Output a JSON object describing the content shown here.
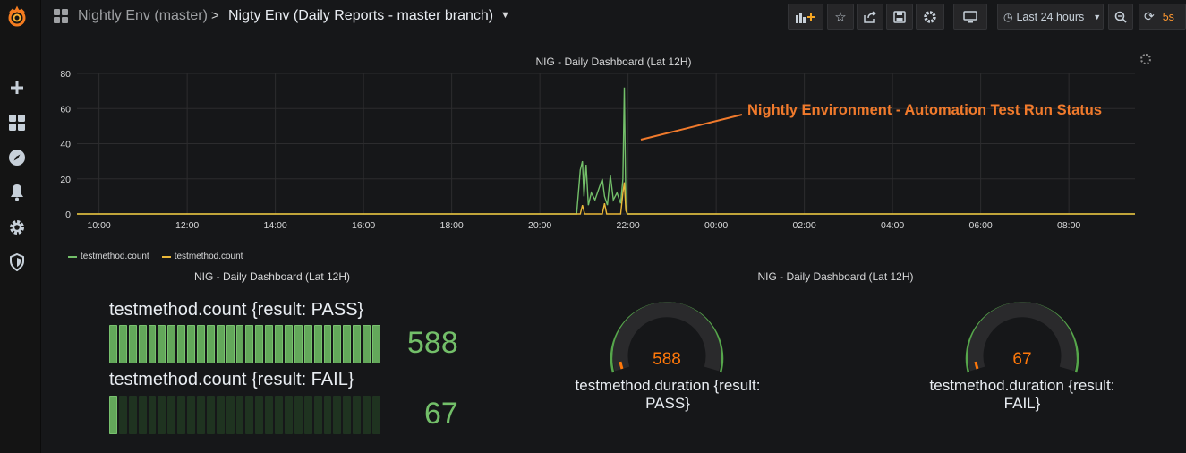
{
  "nav": {
    "icons": [
      "grafana-logo-icon",
      "plus-icon",
      "dashboards-icon",
      "explore-icon",
      "alerting-bell-icon",
      "configuration-gear-icon",
      "shield-icon"
    ]
  },
  "header": {
    "folder": "Nightly Env (master)",
    "separator": ">",
    "title": "Nigty Env (Daily Reports - master branch)",
    "time_picker_label": "Last 24 hours",
    "refresh_interval": "5s"
  },
  "colors": {
    "pass_green": "#73bf69",
    "fail_yellow": "#eab839",
    "annotation_orange": "#f07a2c",
    "gauge_value_orange": "#ff780a"
  },
  "graph_panel": {
    "title": "NIG - Daily Dashboard (Lat 12H)",
    "annotation": "Nightly Environment - Automation Test Run Status",
    "legend": [
      {
        "name": "testmethod.count",
        "color": "#73bf69"
      },
      {
        "name": "testmethod.count",
        "color": "#eab839"
      }
    ]
  },
  "chart_data": {
    "type": "line",
    "x_ticks": [
      "10:00",
      "12:00",
      "14:00",
      "16:00",
      "18:00",
      "20:00",
      "22:00",
      "00:00",
      "02:00",
      "04:00",
      "06:00",
      "08:00"
    ],
    "y_ticks": [
      0,
      20,
      40,
      60,
      80
    ],
    "ylim": [
      0,
      80
    ],
    "grid": true,
    "legend_placement": "bottom-left",
    "series": [
      {
        "name": "testmethod.count",
        "color": "#73bf69",
        "points": [
          [
            "09:30",
            0
          ],
          [
            "20:50",
            0
          ],
          [
            "20:55",
            25
          ],
          [
            "20:58",
            30
          ],
          [
            "21:00",
            10
          ],
          [
            "21:03",
            28
          ],
          [
            "21:06",
            5
          ],
          [
            "21:10",
            12
          ],
          [
            "21:15",
            8
          ],
          [
            "21:20",
            14
          ],
          [
            "21:25",
            20
          ],
          [
            "21:28",
            10
          ],
          [
            "21:32",
            5
          ],
          [
            "21:36",
            22
          ],
          [
            "21:40",
            8
          ],
          [
            "21:45",
            12
          ],
          [
            "21:50",
            6
          ],
          [
            "21:53",
            20
          ],
          [
            "21:55",
            72
          ],
          [
            "21:57",
            5
          ],
          [
            "21:59",
            0
          ],
          [
            "09:30+1",
            0
          ]
        ]
      },
      {
        "name": "testmethod.count",
        "color": "#eab839",
        "points": [
          [
            "09:30",
            0
          ],
          [
            "20:55",
            0
          ],
          [
            "20:58",
            5
          ],
          [
            "21:01",
            0
          ],
          [
            "21:25",
            0
          ],
          [
            "21:28",
            6
          ],
          [
            "21:31",
            0
          ],
          [
            "21:50",
            0
          ],
          [
            "21:53",
            12
          ],
          [
            "21:55",
            18
          ],
          [
            "21:57",
            2
          ],
          [
            "21:59",
            0
          ],
          [
            "09:30+1",
            0
          ]
        ]
      }
    ]
  },
  "bar_gauge_panel": {
    "title": "NIG - Daily Dashboard (Lat 12H)",
    "rows": [
      {
        "label": "testmethod.count {result: PASS}",
        "value": "588",
        "fill_fraction": 1.0
      },
      {
        "label": "testmethod.count {result: FAIL}",
        "value": "67",
        "fill_fraction": 0.05
      }
    ]
  },
  "gauge_panel": {
    "title": "NIG - Daily Dashboard (Lat 12H)",
    "gauges": [
      {
        "label": "testmethod.duration {result: PASS}",
        "value": "588",
        "fill_fraction": 0.02
      },
      {
        "label": "testmethod.duration {result: FAIL}",
        "value": "67",
        "fill_fraction": 0.02
      }
    ]
  }
}
